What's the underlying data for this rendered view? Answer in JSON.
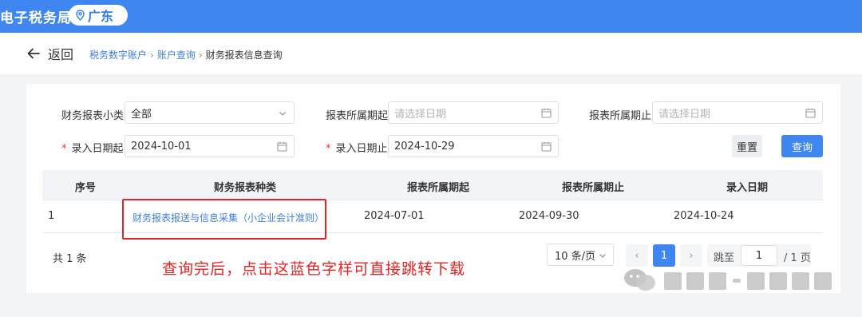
{
  "header": {
    "app_title": "电子税务局",
    "region": "广东"
  },
  "nav": {
    "back_label": "返回",
    "breadcrumb": [
      "税务数字账户",
      "账户查询",
      "财务报表信息查询"
    ]
  },
  "filters": {
    "report_type": {
      "label": "财务报表小类",
      "value": "全部"
    },
    "period_start": {
      "label": "报表所属期起",
      "placeholder": "请选择日期"
    },
    "period_end": {
      "label": "报表所属期止",
      "placeholder": "请选择日期"
    },
    "entry_date_start": {
      "required_mark": "*",
      "label": "录入日期起",
      "value": "2024-10-01"
    },
    "entry_date_end": {
      "required_mark": "*",
      "label": "录入日期止",
      "value": "2024-10-29"
    },
    "reset_label": "重置",
    "query_label": "查询"
  },
  "table": {
    "columns": [
      "序号",
      "财务报表种类",
      "报表所属期起",
      "报表所属期止",
      "录入日期"
    ],
    "rows": [
      {
        "index": "1",
        "report_kind": "财务报表报送与信息采集（小企业会计准则）",
        "period_start": "2024-07-01",
        "period_end": "2024-09-30",
        "entry_date": "2024-10-24"
      }
    ]
  },
  "pagination": {
    "total_text": "共 1 条",
    "page_size": "10 条/页",
    "prev": "‹",
    "current_page": "1",
    "next": "›",
    "jump_label": "跳至",
    "jump_value": "1",
    "total_pages_text": "/ 1 页"
  },
  "annotation": {
    "text": "查询完后，点击这蓝色字样可直接跳转下载",
    "color": "#e52323"
  },
  "colors": {
    "primary": "#3f86f0",
    "link": "#3f7fd9",
    "highlight": "#e52323"
  }
}
